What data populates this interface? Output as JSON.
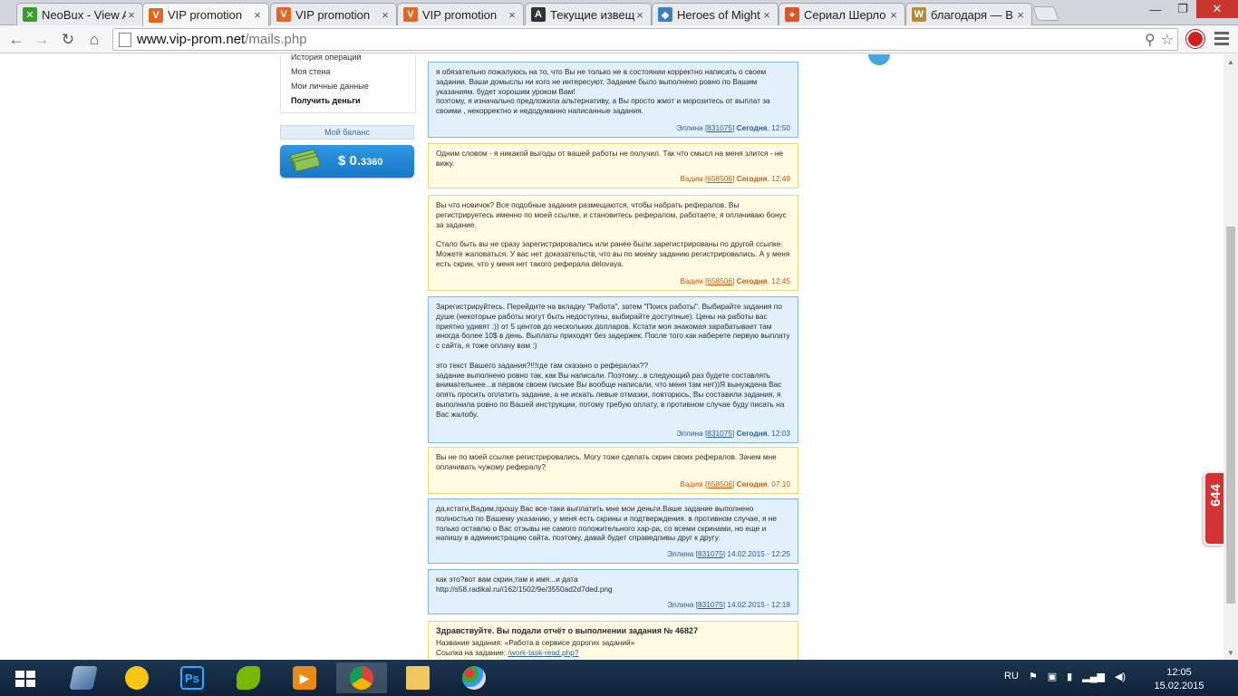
{
  "browser": {
    "tabs": [
      {
        "title": "NeoBux - View A",
        "favicon": "neobux-icon",
        "color": "#3c9a2e",
        "glyph": "✕"
      },
      {
        "title": "VIP promotion",
        "favicon": "vip-icon",
        "color": "#e06820",
        "glyph": "V",
        "active": true
      },
      {
        "title": "VIP promotion",
        "favicon": "vip-icon",
        "color": "#e06820",
        "glyph": "V"
      },
      {
        "title": "VIP promotion",
        "favicon": "vip-icon",
        "color": "#e06820",
        "glyph": "V"
      },
      {
        "title": "Текущие извещ",
        "favicon": "a-icon",
        "color": "#333333",
        "glyph": "A"
      },
      {
        "title": "Heroes of Might",
        "favicon": "heroes-icon",
        "color": "#3d7fc1",
        "glyph": "◆"
      },
      {
        "title": "Сериал Шерло",
        "favicon": "film-icon",
        "color": "#d8582a",
        "glyph": "✦"
      },
      {
        "title": "благодаря — В",
        "favicon": "wiki-icon",
        "color": "#b48a3c",
        "glyph": "W"
      }
    ],
    "url_host": "www.vip-prom.net",
    "url_path": "/mails.php"
  },
  "sidebar": {
    "items": [
      "История операций",
      "Моя стена",
      "Мои личные данные",
      "Получить деньги"
    ],
    "balance_label": "Мой баланс",
    "balance_main": "$ 0.",
    "balance_small": "3360"
  },
  "messages": [
    {
      "body": "я обязательно пожалуюсь на то, что Вы не только не в состоянии корректно написать о своем задании. Ваши домыслы ни кого не интересуют. Задание было выполнено ровно по Вашим указаниям. будет хорошим уроком Вам!\nпоэтому, я изначально предложила альтернативу, а Вы просто жмот и морозитесь от выплат за своими , некорректно и недодуманно написанные задания.",
      "author": "Эллина",
      "id": "831075",
      "date": "Сегодня",
      "time": ", 12:50"
    },
    {
      "body": "Одним словом - я никакой выгоды от вашей работы не получил. Так что смысл на меня злится - не вижу.",
      "author": "Вадим",
      "id": "658506",
      "date": "Сегодня",
      "time": ", 12:49"
    },
    {
      "body": "Вы что новичок? Все подобные задания размещаются, чтобы набрать рефералов. Вы регистрируетесь именно по моей ссылке, и становитесь рефералом, работаете, я оплачиваю бонус за задание.\n\nСтало быть вы не сразу зарегистрировались или ранее были зарегистрированы по другой ссылке. Можете жаловаться. У вас нет доказательств, что вы по моему заданию регистрировались. А у меня есть скрин, что у меня нет такого реферала delovaya.",
      "author": "Вадим",
      "id": "658506",
      "date": "Сегодня",
      "time": ", 12:45"
    },
    {
      "body": "Зарегистрируйтесь. Перейдите на вкладку \"Работа\", затем \"Поиск работы\". Выбирайте задания по душе (некоторые работы могут быть недоступны, выбирайте доступные). Цены на работы вас приятно удивят :)) от 5 центов до нескольких долларов. Кстати моя знакомая зарабатывает там иногда более 10$ в день. Выплаты приходят без задержек. После того как наберете первую выплату с сайта, я тоже оплачу вам :)\n\nэто текст Вашего задания?!!!где там сказано о рефералах??\nзадание выполнено ровно так, как Вы написали. Поэтому...в следующий раз будете составлять внимательнее...в первом своем письме Вы вообще написали, что меня там нет))Я вынуждена Вас опять просить оплатить задание, а не искать левые отмазки, повторюсь, Вы составили задания, я выполнила ровно по Вашей инструкции, потому требую оплату, в противном случае буду писать на Вас жалобу.",
      "author": "Эллина",
      "id": "831075",
      "date": "Сегодня",
      "time": ", 12:03"
    },
    {
      "body": "Вы не по моей ссылке регистрировались. Могу тоже сделать скрин своих рефералов. Зачем мне оплачивать чужому рефералу?",
      "author": "Вадим",
      "id": "658506",
      "date": "Сегодня",
      "time": ", 07:10"
    },
    {
      "body": "да,кстати,Вадим,прошу Вас все-таки выплатить мне мои деньги.Ваше задание выполнено полностью по Вашему указанию, у меня есть скрины и подтверждения. в противном случае, я не только оставлю о Вас отзывы не самого положительного хар-ра, со всеми скринами, но еще и напишу в администрацию сайта. поэтому, давай будет справедливы друг к другу.",
      "author": "Эллина",
      "id": "831075",
      "date": "",
      "time": " 14.02.2015 - 12:25"
    },
    {
      "body": "как это?вот вам скрин,там и имя...и дата\nhttp://s58.radikal.ru/i162/1502/9e/3550ad2d7ded.png",
      "author": "Эллина",
      "id": "831075",
      "date": "",
      "time": " 14.02.2015 - 12:18"
    }
  ],
  "report": {
    "heading": "Здравствуйте. Вы подали отчёт о выполнении задания № 46827",
    "name_line": "Название задания: «Работа в сервисе дорогих заданий»",
    "link_label": "Ссылка на задание: ",
    "link_text": "/work-task-read.php?"
  },
  "side_counter": "644",
  "taskbar": {
    "lang": "RU",
    "time": "12:05",
    "date": "15.02.2015"
  }
}
